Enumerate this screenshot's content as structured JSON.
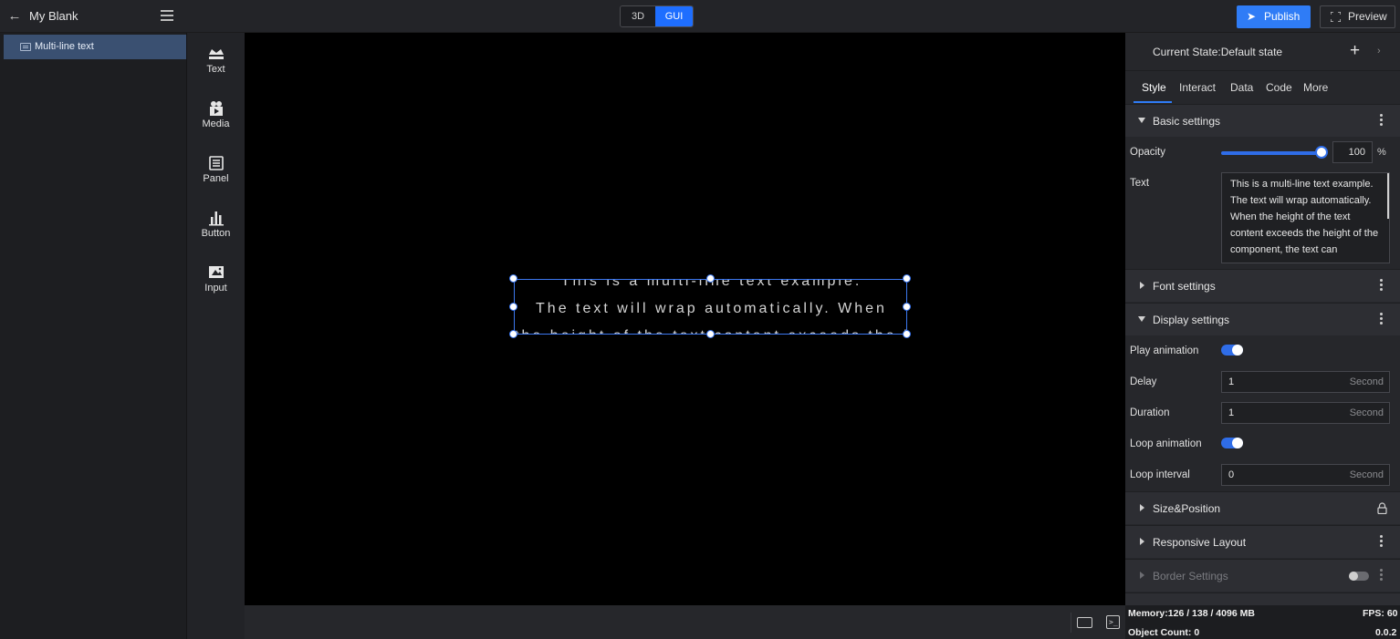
{
  "header": {
    "project_title": "My Blank",
    "modes": [
      "3D",
      "GUI"
    ],
    "active_mode": "GUI",
    "publish_label": "Publish",
    "preview_label": "Preview"
  },
  "layers": {
    "items": [
      {
        "label": "Multi-line text",
        "selected": true
      }
    ]
  },
  "palette": {
    "items": [
      {
        "label": "Text",
        "icon": "text-crown-icon"
      },
      {
        "label": "Media",
        "icon": "media-icon"
      },
      {
        "label": "Panel",
        "icon": "panel-icon"
      },
      {
        "label": "Button",
        "icon": "button-chart-icon"
      },
      {
        "label": "Input",
        "icon": "input-icon"
      }
    ]
  },
  "canvas": {
    "text_lines": [
      "This is a multi-line text example.",
      "The text will wrap automatically. When",
      "the height of the text content exceeds the height of"
    ]
  },
  "properties": {
    "current_state": "Current State:Default state",
    "tabs": [
      "Style",
      "Interact",
      "Data",
      "Code",
      "More"
    ],
    "active_tab": "Style",
    "sections": {
      "basic": "Basic settings",
      "font": "Font settings",
      "display": "Display settings",
      "size": "Size&Position",
      "responsive": "Responsive Layout",
      "border": "Border Settings"
    },
    "opacity": {
      "label": "Opacity",
      "value": "100",
      "unit": "%",
      "fraction": 1.0
    },
    "text": {
      "label": "Text",
      "value": "This is a multi-line text example. The text will wrap automatically. When the height of the text content exceeds the height of the component, the text can"
    },
    "play_animation": {
      "label": "Play animation",
      "on": true
    },
    "delay": {
      "label": "Delay",
      "value": "1",
      "unit": "Second"
    },
    "duration": {
      "label": "Duration",
      "value": "1",
      "unit": "Second"
    },
    "loop_animation": {
      "label": "Loop animation",
      "on": true
    },
    "loop_interval": {
      "label": "Loop interval",
      "value": "0",
      "unit": "Second"
    },
    "border_enabled": false
  },
  "status": {
    "memory": "Memory:126 / 138 / 4096 MB",
    "fps": "FPS: 60",
    "object_count": "Object Count: 0",
    "version": "0.0.2"
  },
  "colors": {
    "accent": "#2f7cf6",
    "selection": "#3c78f0",
    "selected_layer": "#3a5071"
  }
}
